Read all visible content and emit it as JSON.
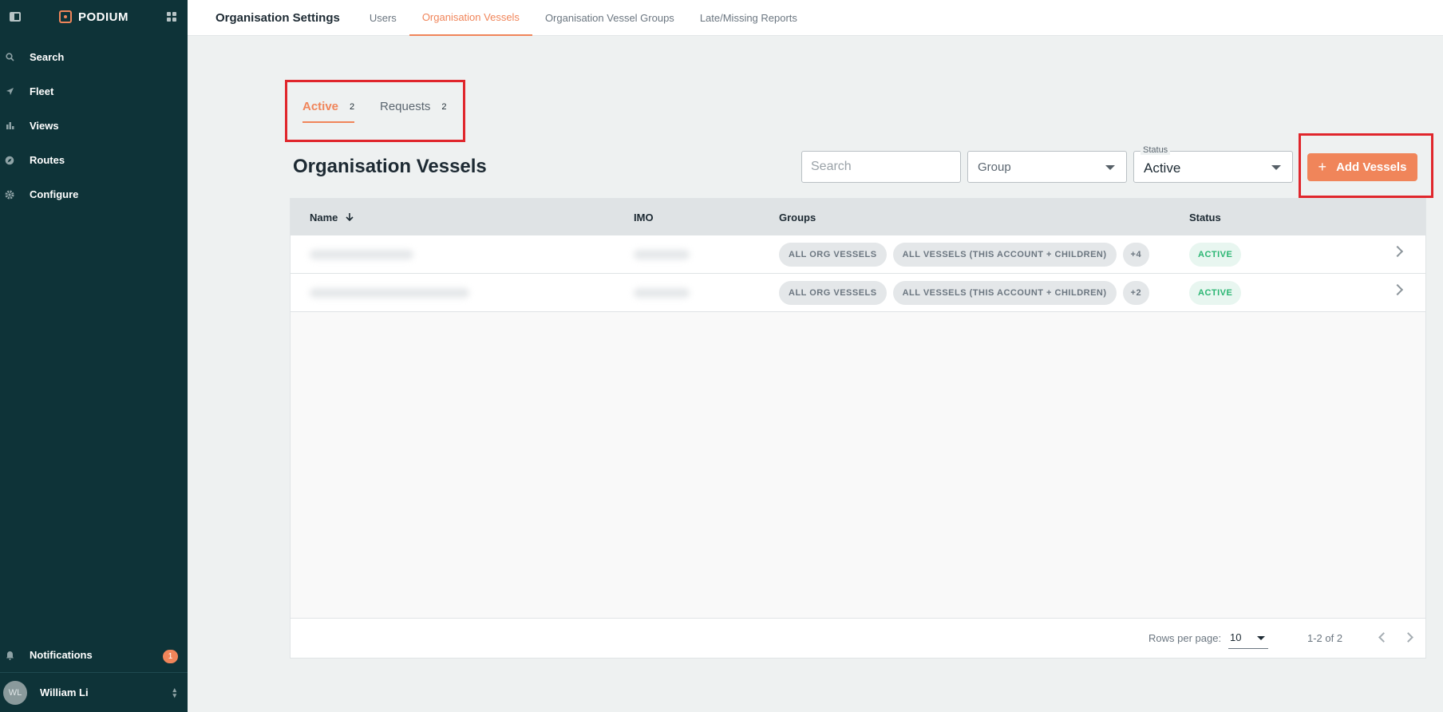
{
  "app": {
    "brand": "PODIUM"
  },
  "sidebar": {
    "items": [
      {
        "label": "Search",
        "icon": "search-icon"
      },
      {
        "label": "Fleet",
        "icon": "navigation-arrow-icon"
      },
      {
        "label": "Views",
        "icon": "bar-chart-icon"
      },
      {
        "label": "Routes",
        "icon": "compass-icon"
      },
      {
        "label": "Configure",
        "icon": "gear-icon"
      }
    ],
    "notifications": {
      "label": "Notifications",
      "count": "1"
    },
    "user": {
      "initials": "WL",
      "name": "William Li"
    }
  },
  "topbar": {
    "title": "Organisation Settings",
    "tabs": [
      {
        "label": "Users",
        "active": false
      },
      {
        "label": "Organisation Vessels",
        "active": true
      },
      {
        "label": "Organisation Vessel Groups",
        "active": false
      },
      {
        "label": "Late/Missing Reports",
        "active": false
      }
    ]
  },
  "subtabs": [
    {
      "label": "Active",
      "count": "2",
      "active": true
    },
    {
      "label": "Requests",
      "count": "2",
      "active": false
    }
  ],
  "section": {
    "title": "Organisation Vessels"
  },
  "filters": {
    "search_placeholder": "Search",
    "group_placeholder": "Group",
    "status_label": "Status",
    "status_value": "Active"
  },
  "add_button": {
    "label": "Add Vessels"
  },
  "table": {
    "headers": {
      "name": "Name",
      "imo": "IMO",
      "groups": "Groups",
      "status": "Status"
    },
    "rows": [
      {
        "groups": [
          "ALL ORG VESSELS",
          "ALL VESSELS (THIS ACCOUNT + CHILDREN)"
        ],
        "more": "+4",
        "status": "ACTIVE"
      },
      {
        "groups": [
          "ALL ORG VESSELS",
          "ALL VESSELS (THIS ACCOUNT + CHILDREN)"
        ],
        "more": "+2",
        "status": "ACTIVE"
      }
    ]
  },
  "pagination": {
    "rows_per_page_label": "Rows per page:",
    "rows_per_page": "10",
    "range": "1-2 of 2"
  },
  "colors": {
    "accent": "#f0855a",
    "sidebar": "#0e3338",
    "active_status": "#2bb673",
    "highlight": "#e0262c"
  }
}
